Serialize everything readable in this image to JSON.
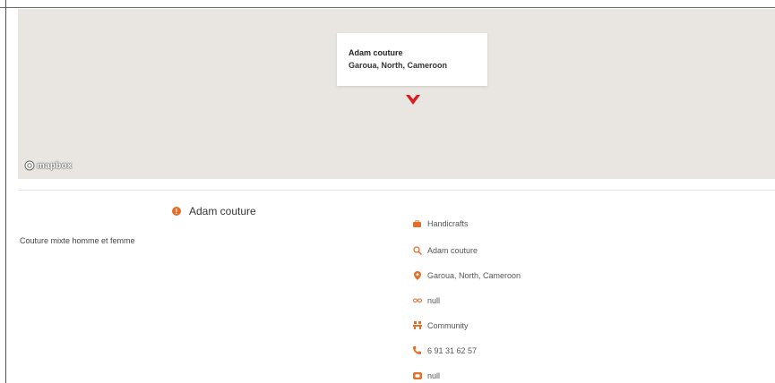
{
  "colors": {
    "accent": "#e2702b",
    "marker": "#d81e1e",
    "map_bg": "#e9e6e1"
  },
  "map": {
    "popup": {
      "title": "Adam couture",
      "subtitle": "Garoua, North, Cameroon"
    },
    "attribution_logo": "mapbox",
    "marker_icon": "map-pin-icon"
  },
  "listing": {
    "name": "Adam couture",
    "name_icon": "info-icon",
    "description": "Couture mixte homme et femme",
    "details": [
      {
        "icon": "briefcase-icon",
        "text": "Handicrafts"
      },
      {
        "icon": "search-icon",
        "text": "Adam couture"
      },
      {
        "icon": "location-pin-icon",
        "text": "Garoua, North, Cameroon"
      },
      {
        "icon": "link-icon",
        "text": "null"
      },
      {
        "icon": "community-icon",
        "text": "Community"
      },
      {
        "icon": "phone-icon",
        "text": "6 91 31 62 57"
      },
      {
        "icon": "email-icon",
        "text": "null"
      }
    ]
  }
}
